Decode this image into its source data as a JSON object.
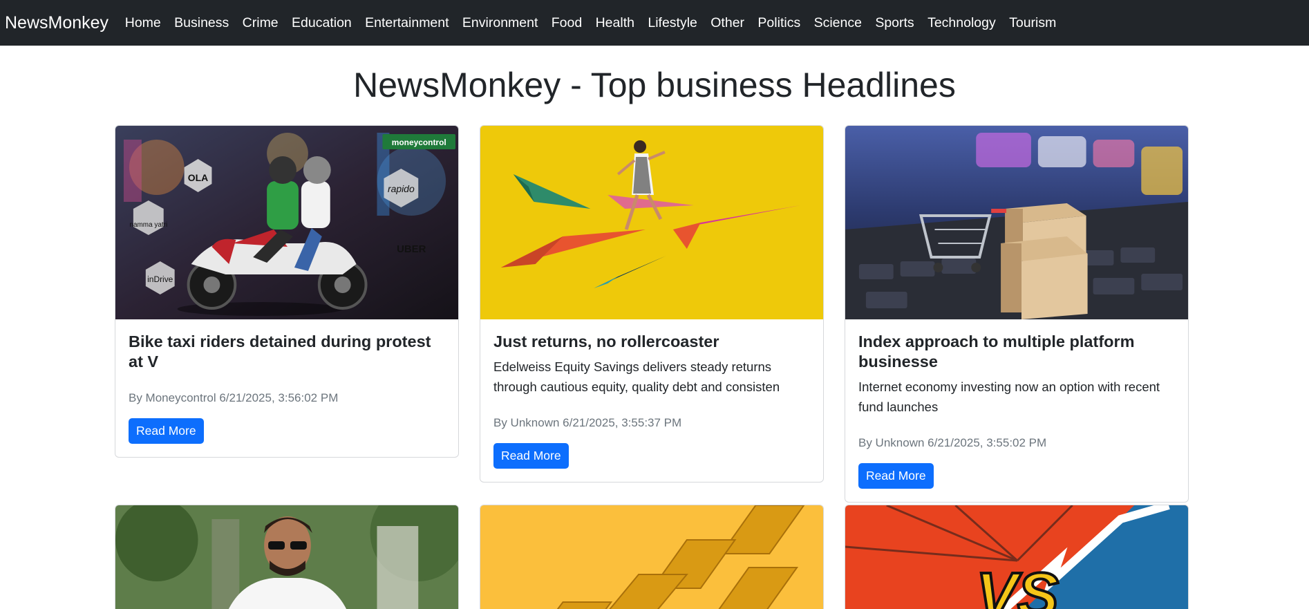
{
  "navbar": {
    "brand": "NewsMonkey",
    "links": [
      "Home",
      "Business",
      "Crime",
      "Education",
      "Entertainment",
      "Environment",
      "Food",
      "Health",
      "Lifestyle",
      "Other",
      "Politics",
      "Science",
      "Sports",
      "Technology",
      "Tourism"
    ]
  },
  "page": {
    "title": "NewsMonkey - Top business Headlines"
  },
  "cards": [
    {
      "title": "Bike taxi riders detained during protest at V",
      "description": "",
      "meta": "By Moneycontrol 6/21/2025, 3:56:02 PM",
      "button": "Read More",
      "image_texts": [
        "moneycontrol",
        "OLA",
        "rapido",
        "namma yatri",
        "UBER",
        "inDrive"
      ]
    },
    {
      "title": "Just returns, no rollercoaster",
      "description": "Edelweiss Equity Savings delivers steady returns through cautious equity, quality debt and consisten",
      "meta": "By Unknown 6/21/2025, 3:55:37 PM",
      "button": "Read More",
      "image_texts": []
    },
    {
      "title": "Index approach to multiple platform businesse",
      "description": "Internet economy investing now an option with recent fund launches",
      "meta": "By Unknown 6/21/2025, 3:55:02 PM",
      "button": "Read More",
      "image_texts": []
    },
    {
      "title": "",
      "description": "",
      "meta": "",
      "button": "",
      "image_texts": []
    },
    {
      "title": "",
      "description": "",
      "meta": "",
      "button": "",
      "image_texts": []
    },
    {
      "title": "",
      "description": "",
      "meta": "",
      "button": "",
      "image_texts": [
        "VS"
      ]
    }
  ],
  "colors": {
    "navbar": "#212529",
    "primary_button": "#0d6efd",
    "muted_text": "#6c757d",
    "card_border": "#d6d8db"
  }
}
